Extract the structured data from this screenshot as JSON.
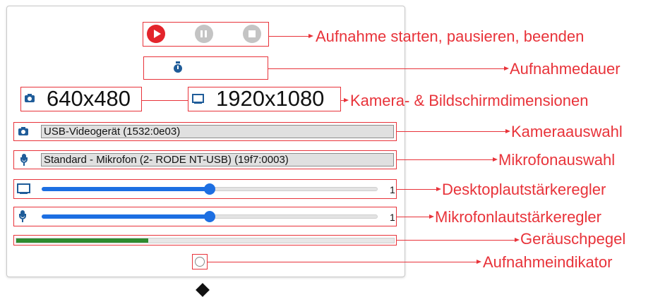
{
  "recorder": {
    "camera_dimensions": "640x480",
    "screen_dimensions": "1920x1080",
    "camera_select": {
      "value": "USB-Videogerät (1532:0e03)"
    },
    "mic_select": {
      "value": "Standard - Mikrofon (2- RODE NT-USB) (19f7:0003)"
    },
    "desktop_volume": {
      "value": 1,
      "fraction": 0.5
    },
    "mic_volume": {
      "value": 1,
      "fraction": 0.5
    },
    "noise_level": {
      "fraction": 0.35
    },
    "colors": {
      "record": "#e3242b",
      "disabled": "#c4c4c4",
      "slider": "#1d6fe2",
      "meter": "#2e8b2e",
      "icon": "#1f5c99"
    }
  },
  "callouts": {
    "controls": "Aufnahme starten, pausieren, beenden",
    "duration": "Aufnahmedauer",
    "dimensions": "Kamera- & Bildschirmdimensionen",
    "camera_select": "Kameraauswahl",
    "mic_select": "Mikrofonauswahl",
    "desktop_volume": "Desktoplautstärkeregler",
    "mic_volume": "Mikrofonlautstärkeregler",
    "noise_level": "Geräuschpegel",
    "indicator": "Aufnahmeindikator"
  },
  "icons": [
    "play-icon",
    "pause-icon",
    "stop-icon",
    "stopwatch-icon",
    "camera-icon",
    "monitor-icon",
    "microphone-icon",
    "record-indicator-icon"
  ]
}
